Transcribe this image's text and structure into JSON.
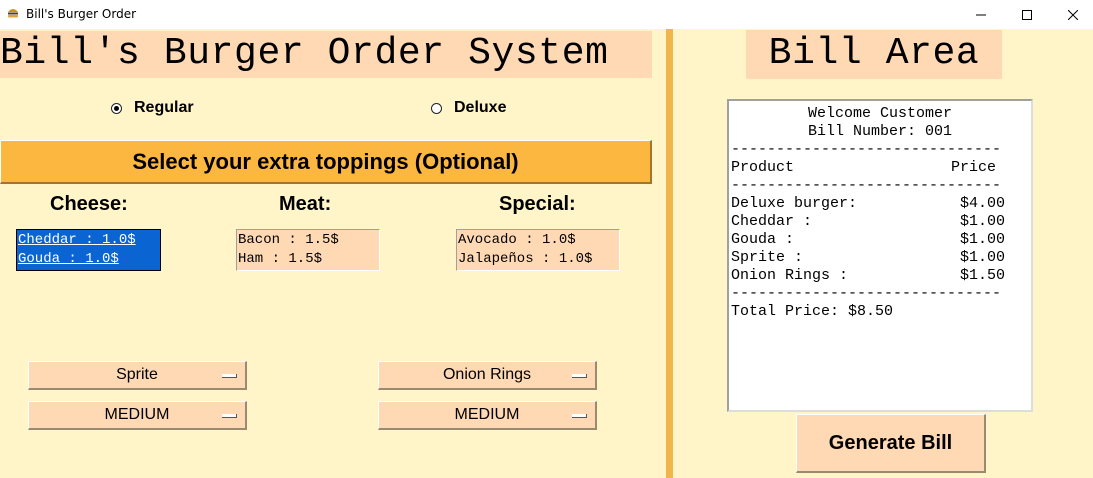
{
  "window": {
    "title": "Bill's Burger Order",
    "app_icon": "burger-icon"
  },
  "order_panel": {
    "title": "Bill's Burger Order System",
    "burger_types": [
      {
        "label": "Regular",
        "selected": true
      },
      {
        "label": "Deluxe",
        "selected": false
      }
    ],
    "toppings_heading": "Select your extra toppings (Optional)",
    "categories": [
      {
        "label": "Cheese:",
        "items": [
          "Cheddar : 1.0$",
          "Gouda : 1.0$"
        ]
      },
      {
        "label": "Meat:",
        "items": [
          "Bacon : 1.5$",
          "Ham : 1.5$"
        ]
      },
      {
        "label": "Special:",
        "items": [
          "Avocado : 1.0$",
          "Jalapeños : 1.0$"
        ]
      }
    ],
    "drink_select": "Sprite",
    "drink_size_select": "MEDIUM",
    "side_select": "Onion Rings",
    "side_size_select": "MEDIUM"
  },
  "bill_panel": {
    "title": "Bill Area",
    "welcome": "Welcome Customer",
    "bill_number": "Bill Number: 001",
    "separator": "------------------------------",
    "header_product": "Product",
    "header_price": "Price",
    "lines": [
      {
        "product": "Deluxe burger:",
        "price": "$4.00"
      },
      {
        "product": "Cheddar :",
        "price": "$1.00"
      },
      {
        "product": "Gouda :",
        "price": "$1.00"
      },
      {
        "product": "Sprite :",
        "price": "$1.00"
      },
      {
        "product": "Onion Rings :",
        "price": "$1.50"
      }
    ],
    "total": "Total Price: $8.50",
    "generate_button": "Generate Bill"
  },
  "colors": {
    "background": "#fff5c8",
    "panel_peach": "#ffd9b3",
    "banner_orange": "#fbb73f",
    "divider": "#f0b64a",
    "selection_blue": "#0a64d2"
  }
}
